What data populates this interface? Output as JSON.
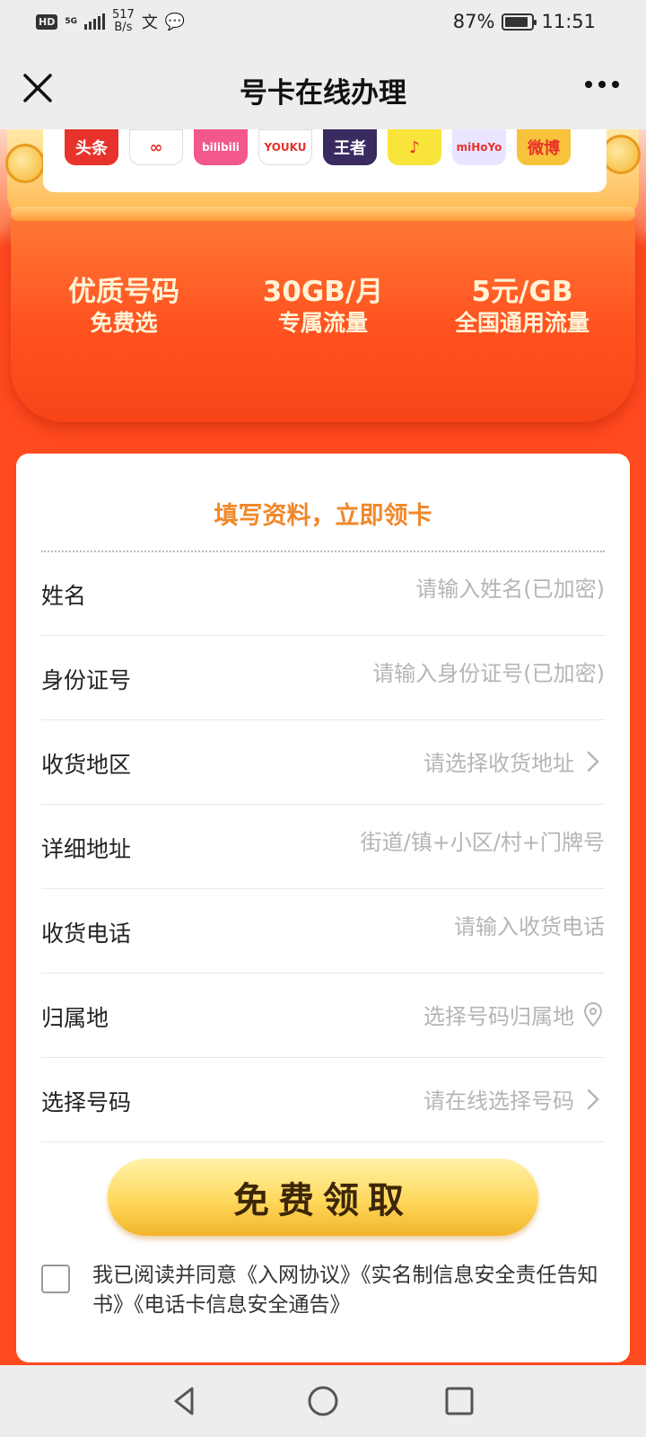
{
  "status_bar": {
    "hd": "HD",
    "network": "5G",
    "speed_value": "517",
    "speed_unit": "B/s",
    "battery": "87%",
    "battery_level": 0.87,
    "time": "11:51"
  },
  "nav": {
    "title": "号卡在线办理",
    "close_icon": "close-icon",
    "more_icon": "more-icon"
  },
  "banner": {
    "apps": [
      {
        "label": "头条",
        "color": "#e8322c"
      },
      {
        "label": "∞",
        "color": "#ffffff"
      },
      {
        "label": "bilibili",
        "color": "#f2588a"
      },
      {
        "label": "YOUKU",
        "color": "#ffffff"
      },
      {
        "label": "王者",
        "color": "#3a2a60"
      },
      {
        "label": "♪",
        "color": "#f8e43a"
      },
      {
        "label": "miHoYo",
        "color": "#e9e4ff"
      },
      {
        "label": "微博",
        "color": "#f7c33a"
      }
    ],
    "features": [
      {
        "main": "优质号码",
        "sub": "免费选"
      },
      {
        "main": "30GB/月",
        "sub": "专属流量"
      },
      {
        "main": "5元/GB",
        "sub": "全国通用流量"
      }
    ]
  },
  "form": {
    "title": "填写资料，立即领卡",
    "fields": {
      "name": {
        "label": "姓名",
        "placeholder": "请输入姓名(已加密)"
      },
      "id_number": {
        "label": "身份证号",
        "placeholder": "请输入身份证号(已加密)"
      },
      "region": {
        "label": "收货地区",
        "value": "请选择收货地址"
      },
      "address": {
        "label": "详细地址",
        "placeholder": "街道/镇+小区/村+门牌号"
      },
      "phone": {
        "label": "收货电话",
        "placeholder": "请输入收货电话"
      },
      "home_location": {
        "label": "归属地",
        "value": "选择号码归属地"
      },
      "number": {
        "label": "选择号码",
        "value": "请在线选择号码"
      }
    },
    "submit_label": "免费领取",
    "agreement": "我已阅读并同意《入网协议》《实名制信息安全责任告知书》《电话卡信息安全通告》"
  },
  "accent_colors": {
    "primary_red": "#ff4a1f",
    "title_orange": "#f0882a",
    "button_gold": "#ffd85c"
  }
}
